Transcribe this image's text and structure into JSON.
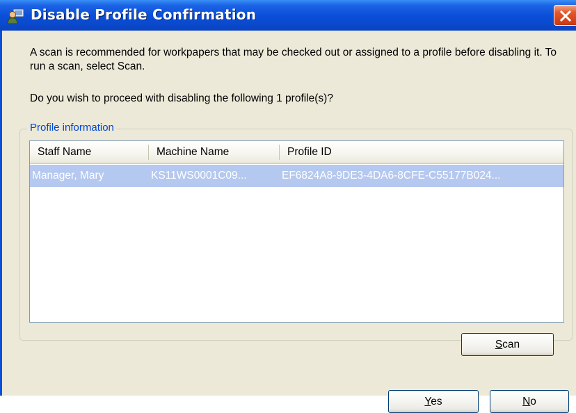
{
  "window": {
    "title": "Disable Profile Confirmation",
    "accent_color": "#0b4fd8",
    "close_icon": "close-icon"
  },
  "message": {
    "line1": "A scan is recommended for workpapers that may be checked out or assigned to a profile before disabling it. To run a scan, select Scan.",
    "line2": "Do you wish to proceed with disabling the following 1 profile(s)?"
  },
  "group": {
    "legend": "Profile information"
  },
  "table": {
    "columns": [
      "Staff Name",
      "Machine Name",
      "Profile ID"
    ],
    "rows": [
      {
        "staff_name": "Manager, Mary",
        "machine_name": "KS11WS0001C09...",
        "profile_id": "EF6824A8-9DE3-4DA6-8CFE-C55177B024..."
      }
    ],
    "selected_row_color": "#b5c8f0"
  },
  "buttons": {
    "scan": {
      "mnemonic": "S",
      "rest": "can"
    },
    "yes": {
      "mnemonic": "Y",
      "rest": "es"
    },
    "no": {
      "mnemonic": "N",
      "rest": "o"
    }
  }
}
